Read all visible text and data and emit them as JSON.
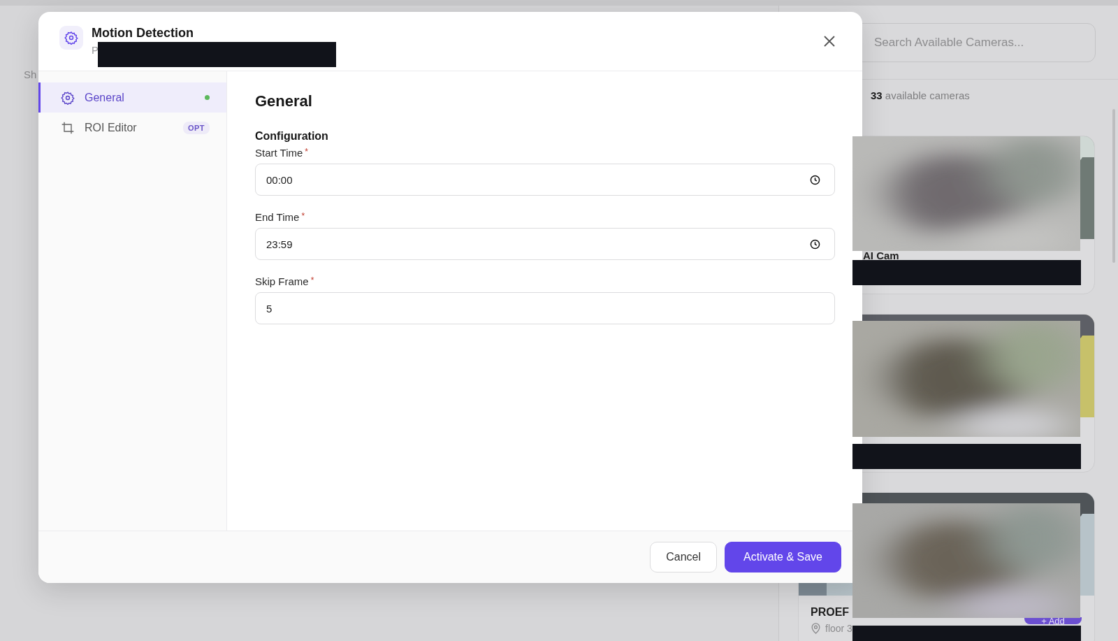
{
  "background": {
    "left_text": "Sh",
    "search": {
      "placeholder": "Search Available Cameras..."
    },
    "count_text": "**33** available cameras",
    "cameras": [
      {
        "kind": "camera",
        "name": "AI Cam"
      },
      {
        "kind": "camera"
      },
      {
        "kind": "camera",
        "name": "PROEF",
        "location": "floor 3",
        "button": "+ Add"
      }
    ]
  },
  "dialog": {
    "title": "Motion Detection",
    "subtitle": "P",
    "sidebar": {
      "items": [
        {
          "label": "General",
          "selected": true,
          "color": "#5cb85c"
        },
        {
          "label": "ROI Editor",
          "selected": false,
          "badge": "OPT"
        }
      ]
    },
    "section_title": "General",
    "group_title": "Configuration",
    "fields": [
      {
        "label": "Start Time",
        "required_mark": "*",
        "value": "00:00",
        "kind": "time"
      },
      {
        "label": "End Time",
        "required_mark": "*",
        "value": "23:59",
        "kind": "time"
      },
      {
        "label": "Skip Frame",
        "required_mark": "*",
        "value": "5",
        "kind": "number"
      }
    ],
    "buttons": [
      {
        "label": "Cancel",
        "kind": "secondary"
      },
      {
        "label": "Activate & Save",
        "kind": "primary"
      }
    ]
  }
}
